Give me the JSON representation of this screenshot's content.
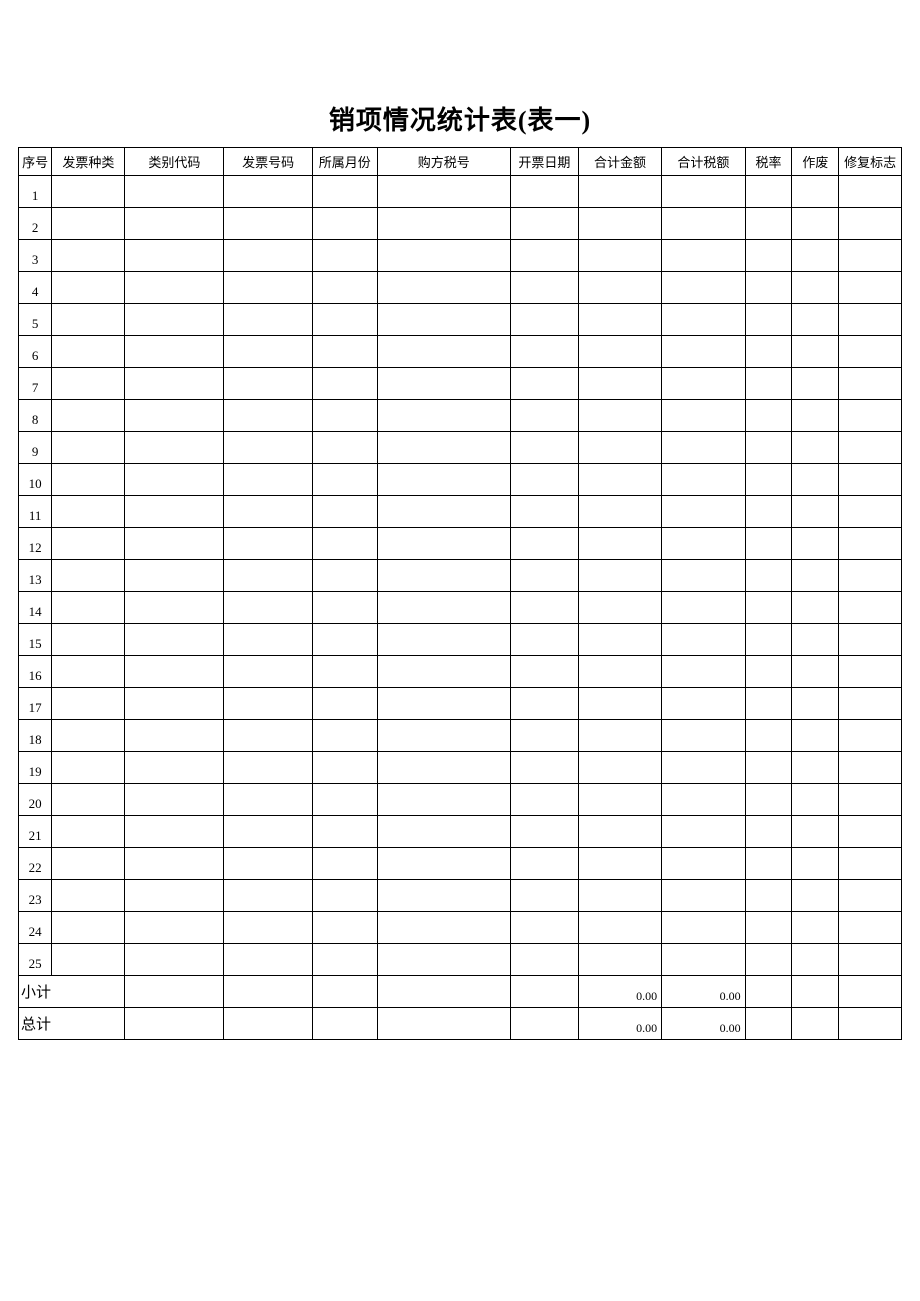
{
  "title": "销项情况统计表(表一)",
  "headers": {
    "seq": "序号",
    "invoice_type": "发票种类",
    "category_code": "类别代码",
    "invoice_number": "发票号码",
    "period": "所属月份",
    "buyer_tax_id": "购方税号",
    "issue_date": "开票日期",
    "total_amount": "合计金额",
    "total_tax": "合计税额",
    "tax_rate": "税率",
    "voided": "作废",
    "repair_flag": "修复标志"
  },
  "rows": [
    {
      "seq": "1"
    },
    {
      "seq": "2"
    },
    {
      "seq": "3"
    },
    {
      "seq": "4"
    },
    {
      "seq": "5"
    },
    {
      "seq": "6"
    },
    {
      "seq": "7"
    },
    {
      "seq": "8"
    },
    {
      "seq": "9"
    },
    {
      "seq": "10"
    },
    {
      "seq": "11"
    },
    {
      "seq": "12"
    },
    {
      "seq": "13"
    },
    {
      "seq": "14"
    },
    {
      "seq": "15"
    },
    {
      "seq": "16"
    },
    {
      "seq": "17"
    },
    {
      "seq": "18"
    },
    {
      "seq": "19"
    },
    {
      "seq": "20"
    },
    {
      "seq": "21"
    },
    {
      "seq": "22"
    },
    {
      "seq": "23"
    },
    {
      "seq": "24"
    },
    {
      "seq": "25"
    }
  ],
  "subtotal": {
    "label": "小计",
    "total_amount": "0.00",
    "total_tax": "0.00"
  },
  "grandtotal": {
    "label": "总计",
    "total_amount": "0.00",
    "total_tax": "0.00"
  }
}
